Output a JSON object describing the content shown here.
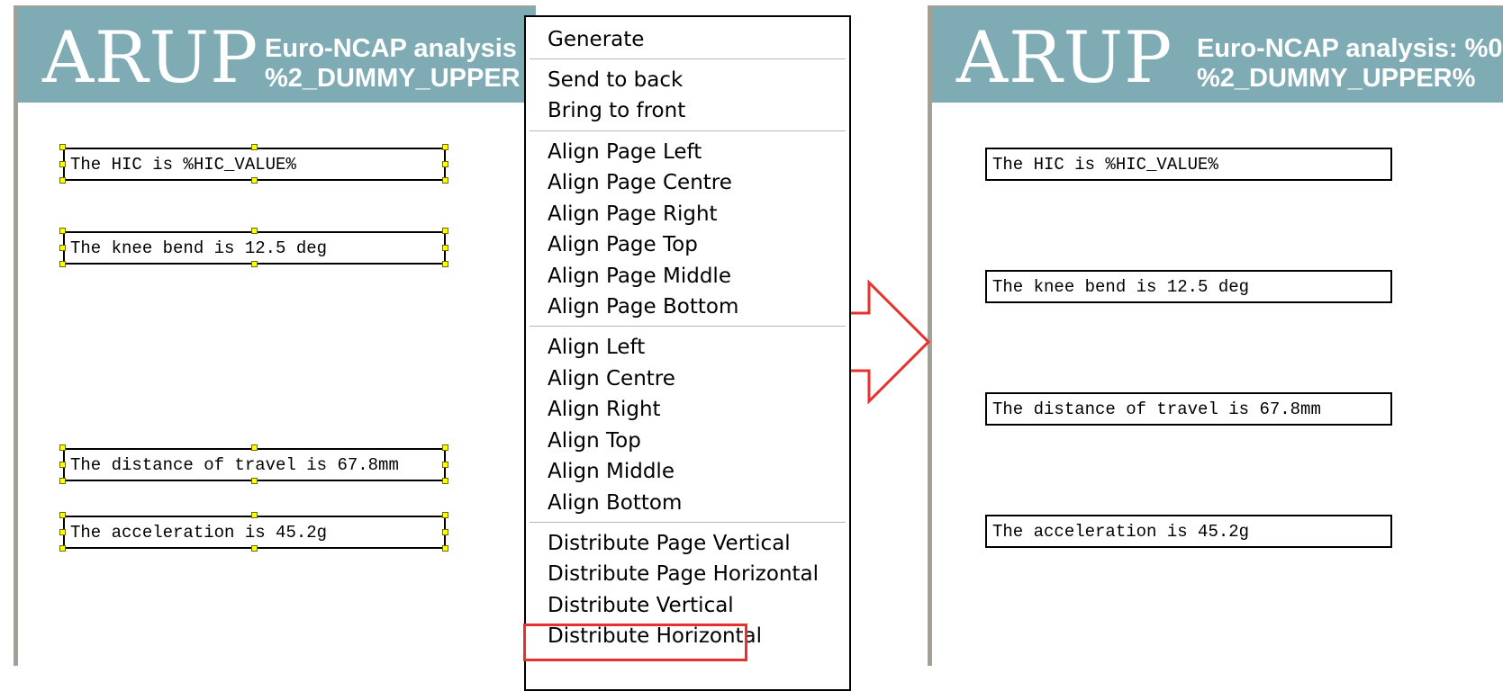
{
  "logo_text": "ARUP",
  "banner_title_left": {
    "line1": "Euro-NCAP analysis",
    "line2": "%2_DUMMY_UPPER"
  },
  "banner_title_right": {
    "line1": "Euro-NCAP analysis: %0",
    "line2": "%2_DUMMY_UPPER%"
  },
  "textboxes": [
    "The HIC is %HIC_VALUE%",
    "The knee bend is 12.5 deg",
    "The distance of travel is 67.8mm",
    "The acceleration is 45.2g"
  ],
  "context_menu": {
    "items": [
      "Generate",
      "Send to back",
      "Bring to front",
      "Align Page Left",
      "Align Page Centre",
      "Align Page Right",
      "Align Page Top",
      "Align Page Middle",
      "Align Page Bottom",
      "Align Left",
      "Align Centre",
      "Align Right",
      "Align Top",
      "Align Middle",
      "Align Bottom",
      "Distribute Page Vertical",
      "Distribute Page Horizontal",
      "Distribute Vertical",
      "Distribute Horizontal"
    ],
    "highlighted_item": "Distribute Vertical"
  },
  "colors": {
    "banner": "#7eabb4",
    "page_border": "#a3a197",
    "handle": "#ffff00",
    "highlight": "#e8312c"
  }
}
